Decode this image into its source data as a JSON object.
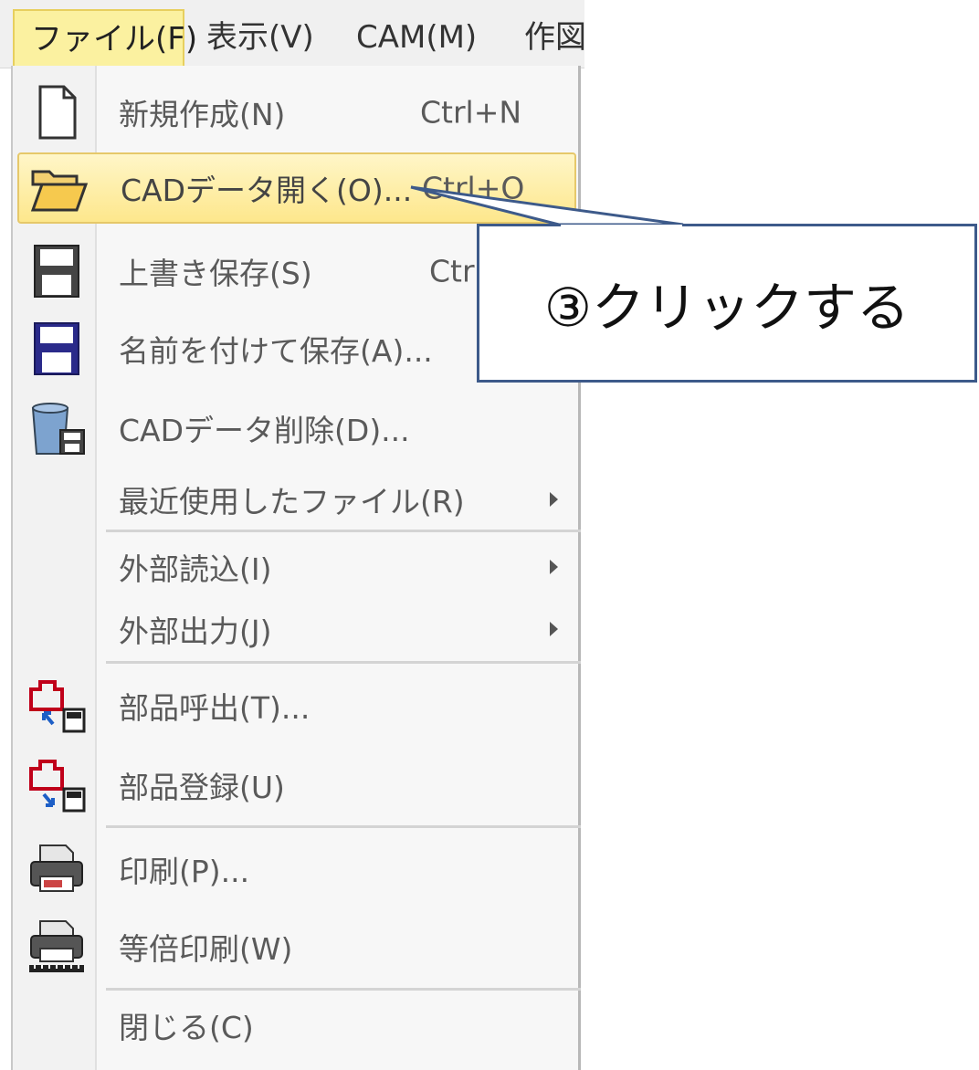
{
  "menubar": {
    "items": [
      {
        "label": "ファイル(F)"
      },
      {
        "label": "表示(V)"
      },
      {
        "label": "CAM(M)"
      },
      {
        "label": "作図"
      }
    ]
  },
  "file_menu": {
    "items": [
      {
        "label": "新規作成(N)",
        "shortcut": "Ctrl+N",
        "icon": "new-file-icon"
      },
      {
        "label": "CADデータ開く(O)...",
        "shortcut": "Ctrl+O",
        "icon": "open-folder-icon",
        "highlighted": true
      },
      {
        "label": "上書き保存(S)",
        "shortcut": "Ctrl",
        "icon": "save-icon"
      },
      {
        "label": "名前を付けて保存(A)...",
        "shortcut": "",
        "icon": "save-as-icon"
      },
      {
        "label": "CADデータ削除(D)...",
        "shortcut": "",
        "icon": "delete-data-icon"
      },
      {
        "label": "最近使用したファイル(R)",
        "submenu": true
      },
      {
        "label": "外部読込(I)",
        "submenu": true
      },
      {
        "label": "外部出力(J)",
        "submenu": true
      },
      {
        "label": "部品呼出(T)...",
        "icon": "part-load-icon"
      },
      {
        "label": "部品登録(U)",
        "icon": "part-register-icon"
      },
      {
        "label": "印刷(P)...",
        "icon": "printer-icon"
      },
      {
        "label": "等倍印刷(W)",
        "icon": "actual-size-print-icon"
      },
      {
        "label": "閉じる(C)"
      }
    ]
  },
  "callout": {
    "text": "③クリックする",
    "border_color": "#3d5a8a"
  },
  "colors": {
    "highlight": "#fde78c",
    "menubar_active": "#fbf1a0"
  }
}
